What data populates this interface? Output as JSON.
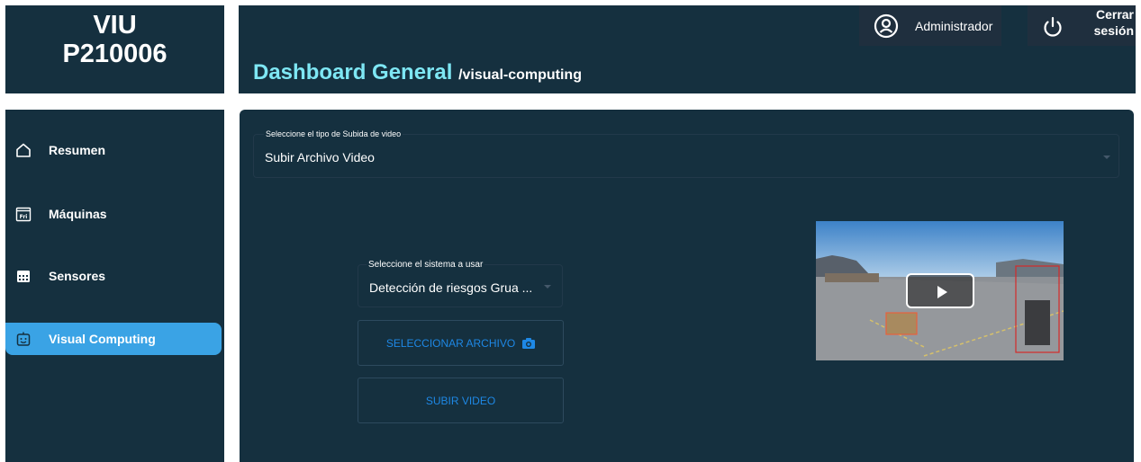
{
  "brand": {
    "line1": "VIU",
    "line2": "P210006"
  },
  "header": {
    "title": "Dashboard General",
    "path": "/visual-computing",
    "user_label": "Administrador",
    "logout_line1": "Cerrar",
    "logout_line2": "sesión"
  },
  "sidebar": {
    "items": [
      {
        "label": "Resumen",
        "icon": "home-icon",
        "active": false
      },
      {
        "label": "Máquinas",
        "icon": "calendar-fri-icon",
        "active": false
      },
      {
        "label": "Sensores",
        "icon": "calendar-grid-icon",
        "active": false
      },
      {
        "label": "Visual Computing",
        "icon": "robot-face-icon",
        "active": true
      }
    ]
  },
  "main": {
    "upload_type": {
      "label": "Seleccione el tipo de Subida de video",
      "value": "Subir Archivo Video"
    },
    "system": {
      "label": "Seleccione el sistema a usar",
      "value": "Detección de riesgos Grua ..."
    },
    "select_file_label": "SELECCIONAR ARCHIVO",
    "upload_video_label": "SUBIR VIDEO"
  },
  "colors": {
    "panel": "#15303f",
    "accent_title": "#7ee7f4",
    "active_nav": "#3aa3e5",
    "button_text": "#1e88e5",
    "header_box": "#1f2f3e"
  }
}
